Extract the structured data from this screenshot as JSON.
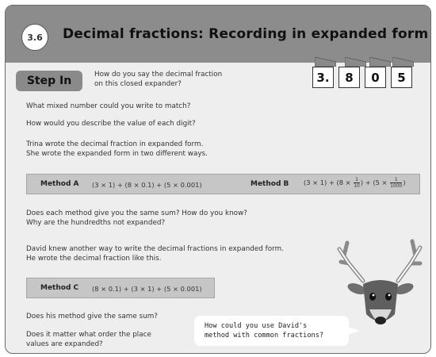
{
  "header": {
    "number": "3.6",
    "title": "Decimal fractions: Recording in expanded form"
  },
  "step_in": {
    "label": "Step In"
  },
  "questions": {
    "q1": [
      "How do you say the decimal fraction",
      "on this closed expander?"
    ],
    "q2": "What mixed number could you write to match?",
    "q3": "How would you describe the value of each digit?",
    "trina": [
      "Trina wrote the decimal fraction in expanded form.",
      "She wrote the expanded form in two different ways."
    ],
    "q4": [
      "Does each method give you the same sum? How do you know?",
      "Why are the hundredths not expanded?"
    ],
    "david": [
      "David knew another way to write the decimal fractions in expanded form.",
      "He wrote the decimal fraction like this."
    ],
    "q5": "Does his method give the same sum?",
    "q6": [
      "Does it matter what order the place",
      "values are expanded?"
    ]
  },
  "expander": {
    "digits": [
      "3.",
      "8",
      "0",
      "5"
    ]
  },
  "method_a": {
    "label": "Method A",
    "expression": "(3 × 1) + (8 × 0.1) + (5 × 0.001)"
  },
  "method_b": {
    "label": "Method B",
    "part1": "(3 × 1) + (8 × ",
    "frac1_num": "1",
    "frac1_den": "10",
    "part2": ") + (5 × ",
    "frac2_num": "1",
    "frac2_den": "1000",
    "part3": ")"
  },
  "method_c": {
    "label": "Method C",
    "expression": "(8 × 0.1) + (3 × 1) + (5 × 0.001)"
  },
  "speech": [
    "How could you use David's",
    "method with common fractions?"
  ]
}
